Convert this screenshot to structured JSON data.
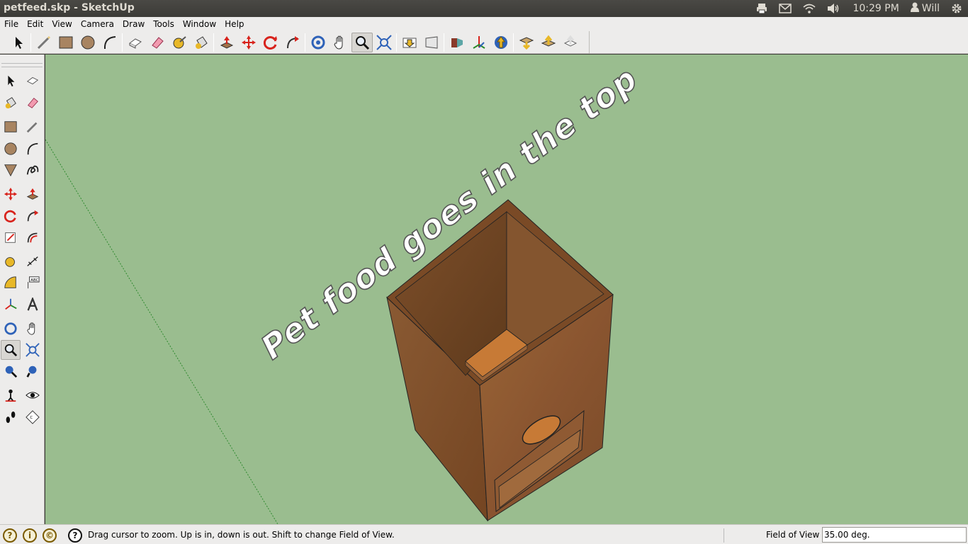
{
  "window": {
    "title": "petfeed.skp - SketchUp"
  },
  "indicators": {
    "time": "10:29 PM",
    "user": "Will",
    "icons": [
      "printer-icon",
      "mail-icon",
      "wifi-icon",
      "volume-icon",
      "user-icon",
      "gear-icon"
    ]
  },
  "menu": [
    {
      "label": "File"
    },
    {
      "label": "Edit"
    },
    {
      "label": "View"
    },
    {
      "label": "Camera"
    },
    {
      "label": "Draw"
    },
    {
      "label": "Tools"
    },
    {
      "label": "Window"
    },
    {
      "label": "Help"
    }
  ],
  "toolbar": {
    "icons": [
      "select-icon",
      "pencil-line-icon",
      "rectangle-icon",
      "circle-icon",
      "arc-icon",
      "make-component-icon",
      "eraser-icon",
      "tape-measure-icon",
      "paint-bucket-icon",
      "push-pull-icon",
      "move-icon",
      "rotate-icon",
      "follow-me-icon",
      "orbit-icon",
      "pan-icon",
      "zoom-icon",
      "zoom-extents-icon",
      "previous-view-icon",
      "next-view-icon",
      "add-location-icon",
      "toggle-terrain-icon",
      "preview-in-earth-icon",
      "get-models-icon",
      "share-model-icon",
      "share-component-icon"
    ],
    "active": "zoom-icon"
  },
  "sidebar": {
    "active": "zoom-icon"
  },
  "model": {
    "text3d": "Pet food goes in the top",
    "colors": {
      "sky": "#9abd8f",
      "wood": "#8f5b32",
      "woodDark": "#6e4020",
      "woodLight": "#c9823e"
    }
  },
  "status": {
    "hint": "Drag cursor to zoom.  Up is in, down is out. Shift to change Field of View.",
    "fov_label": "Field of View",
    "fov_value": "35.00 deg."
  }
}
